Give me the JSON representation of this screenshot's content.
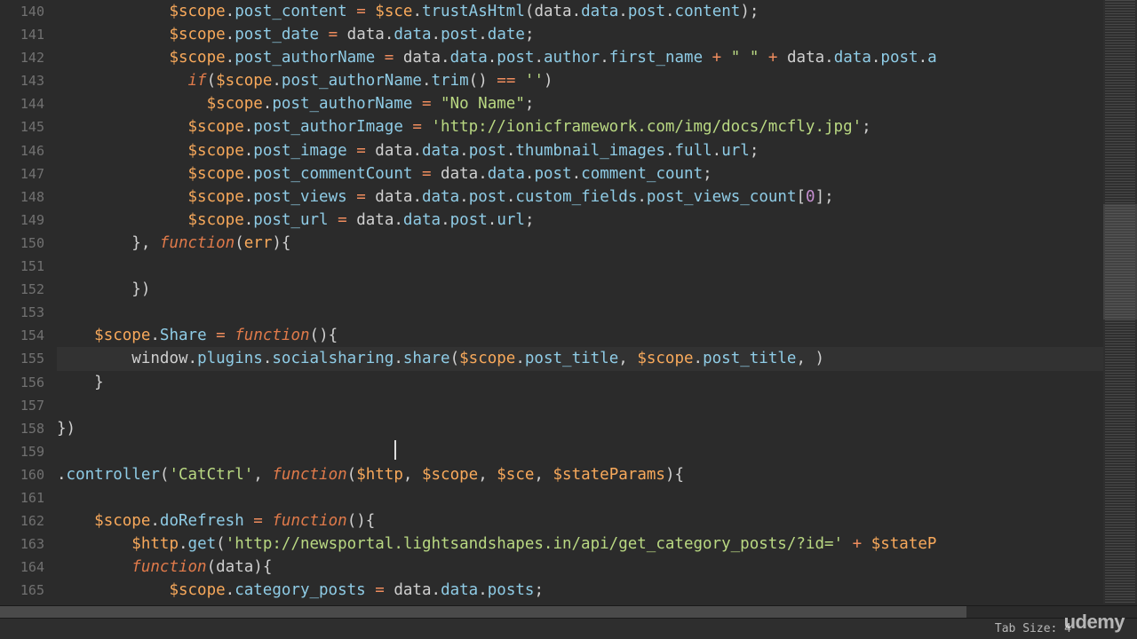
{
  "editor": {
    "first_line_number": 140,
    "active_line": 155,
    "cursor_after_line_index": 19,
    "tab_size_label": "Tab Size: 4"
  },
  "watermark": "udemy",
  "code_lines": [
    [
      [
        "            ",
        "s-punc"
      ],
      [
        "$scope",
        "s-var"
      ],
      [
        ".",
        "s-punc"
      ],
      [
        "post_content",
        "s-prop"
      ],
      [
        " ",
        "s-punc"
      ],
      [
        "=",
        "s-op"
      ],
      [
        " ",
        "s-punc"
      ],
      [
        "$sce",
        "s-var"
      ],
      [
        ".",
        "s-punc"
      ],
      [
        "trustAsHtml",
        "s-prop"
      ],
      [
        "(",
        "s-punc"
      ],
      [
        "data",
        "s-ident"
      ],
      [
        ".",
        "s-punc"
      ],
      [
        "data",
        "s-prop"
      ],
      [
        ".",
        "s-punc"
      ],
      [
        "post",
        "s-prop"
      ],
      [
        ".",
        "s-punc"
      ],
      [
        "content",
        "s-prop"
      ],
      [
        ");",
        "s-punc"
      ]
    ],
    [
      [
        "            ",
        "s-punc"
      ],
      [
        "$scope",
        "s-var"
      ],
      [
        ".",
        "s-punc"
      ],
      [
        "post_date",
        "s-prop"
      ],
      [
        " ",
        "s-punc"
      ],
      [
        "=",
        "s-op"
      ],
      [
        " ",
        "s-punc"
      ],
      [
        "data",
        "s-ident"
      ],
      [
        ".",
        "s-punc"
      ],
      [
        "data",
        "s-prop"
      ],
      [
        ".",
        "s-punc"
      ],
      [
        "post",
        "s-prop"
      ],
      [
        ".",
        "s-punc"
      ],
      [
        "date",
        "s-prop"
      ],
      [
        ";",
        "s-punc"
      ]
    ],
    [
      [
        "            ",
        "s-punc"
      ],
      [
        "$scope",
        "s-var"
      ],
      [
        ".",
        "s-punc"
      ],
      [
        "post_authorName",
        "s-prop"
      ],
      [
        " ",
        "s-punc"
      ],
      [
        "=",
        "s-op"
      ],
      [
        " ",
        "s-punc"
      ],
      [
        "data",
        "s-ident"
      ],
      [
        ".",
        "s-punc"
      ],
      [
        "data",
        "s-prop"
      ],
      [
        ".",
        "s-punc"
      ],
      [
        "post",
        "s-prop"
      ],
      [
        ".",
        "s-punc"
      ],
      [
        "author",
        "s-prop"
      ],
      [
        ".",
        "s-punc"
      ],
      [
        "first_name",
        "s-prop"
      ],
      [
        " ",
        "s-punc"
      ],
      [
        "+",
        "s-op"
      ],
      [
        " ",
        "s-punc"
      ],
      [
        "\" \"",
        "s-str"
      ],
      [
        " ",
        "s-punc"
      ],
      [
        "+",
        "s-op"
      ],
      [
        " ",
        "s-punc"
      ],
      [
        "data",
        "s-ident"
      ],
      [
        ".",
        "s-punc"
      ],
      [
        "data",
        "s-prop"
      ],
      [
        ".",
        "s-punc"
      ],
      [
        "post",
        "s-prop"
      ],
      [
        ".",
        "s-punc"
      ],
      [
        "a",
        "s-prop"
      ]
    ],
    [
      [
        "              ",
        "s-punc"
      ],
      [
        "if",
        "s-kw"
      ],
      [
        "(",
        "s-punc"
      ],
      [
        "$scope",
        "s-var"
      ],
      [
        ".",
        "s-punc"
      ],
      [
        "post_authorName",
        "s-prop"
      ],
      [
        ".",
        "s-punc"
      ],
      [
        "trim",
        "s-prop"
      ],
      [
        "()",
        " s-punc"
      ],
      [
        " ",
        "s-punc"
      ],
      [
        "==",
        "s-op"
      ],
      [
        " ",
        "s-punc"
      ],
      [
        "''",
        "s-str"
      ],
      [
        ")",
        "s-punc"
      ]
    ],
    [
      [
        "                ",
        "s-punc"
      ],
      [
        "$scope",
        "s-var"
      ],
      [
        ".",
        "s-punc"
      ],
      [
        "post_authorName",
        "s-prop"
      ],
      [
        " ",
        "s-punc"
      ],
      [
        "=",
        "s-op"
      ],
      [
        " ",
        "s-punc"
      ],
      [
        "\"No Name\"",
        "s-str"
      ],
      [
        ";",
        "s-punc"
      ]
    ],
    [
      [
        "              ",
        "s-punc"
      ],
      [
        "$scope",
        "s-var"
      ],
      [
        ".",
        "s-punc"
      ],
      [
        "post_authorImage",
        "s-prop"
      ],
      [
        " ",
        "s-punc"
      ],
      [
        "=",
        "s-op"
      ],
      [
        " ",
        "s-punc"
      ],
      [
        "'http://ionicframework.com/img/docs/mcfly.jpg'",
        "s-str"
      ],
      [
        ";",
        "s-punc"
      ]
    ],
    [
      [
        "              ",
        "s-punc"
      ],
      [
        "$scope",
        "s-var"
      ],
      [
        ".",
        "s-punc"
      ],
      [
        "post_image",
        "s-prop"
      ],
      [
        " ",
        "s-punc"
      ],
      [
        "=",
        "s-op"
      ],
      [
        " ",
        "s-punc"
      ],
      [
        "data",
        "s-ident"
      ],
      [
        ".",
        "s-punc"
      ],
      [
        "data",
        "s-prop"
      ],
      [
        ".",
        "s-punc"
      ],
      [
        "post",
        "s-prop"
      ],
      [
        ".",
        "s-punc"
      ],
      [
        "thumbnail_images",
        "s-prop"
      ],
      [
        ".",
        "s-punc"
      ],
      [
        "full",
        "s-prop"
      ],
      [
        ".",
        "s-punc"
      ],
      [
        "url",
        "s-prop"
      ],
      [
        ";",
        "s-punc"
      ]
    ],
    [
      [
        "              ",
        "s-punc"
      ],
      [
        "$scope",
        "s-var"
      ],
      [
        ".",
        "s-punc"
      ],
      [
        "post_commentCount",
        "s-prop"
      ],
      [
        " ",
        "s-punc"
      ],
      [
        "=",
        "s-op"
      ],
      [
        " ",
        "s-punc"
      ],
      [
        "data",
        "s-ident"
      ],
      [
        ".",
        "s-punc"
      ],
      [
        "data",
        "s-prop"
      ],
      [
        ".",
        "s-punc"
      ],
      [
        "post",
        "s-prop"
      ],
      [
        ".",
        "s-punc"
      ],
      [
        "comment_count",
        "s-prop"
      ],
      [
        ";",
        "s-punc"
      ]
    ],
    [
      [
        "              ",
        "s-punc"
      ],
      [
        "$scope",
        "s-var"
      ],
      [
        ".",
        "s-punc"
      ],
      [
        "post_views",
        "s-prop"
      ],
      [
        " ",
        "s-punc"
      ],
      [
        "=",
        "s-op"
      ],
      [
        " ",
        "s-punc"
      ],
      [
        "data",
        "s-ident"
      ],
      [
        ".",
        "s-punc"
      ],
      [
        "data",
        "s-prop"
      ],
      [
        ".",
        "s-punc"
      ],
      [
        "post",
        "s-prop"
      ],
      [
        ".",
        "s-punc"
      ],
      [
        "custom_fields",
        "s-prop"
      ],
      [
        ".",
        "s-punc"
      ],
      [
        "post_views_count",
        "s-prop"
      ],
      [
        "[",
        "s-punc"
      ],
      [
        "0",
        "s-num"
      ],
      [
        "];",
        "s-punc"
      ]
    ],
    [
      [
        "              ",
        "s-punc"
      ],
      [
        "$scope",
        "s-var"
      ],
      [
        ".",
        "s-punc"
      ],
      [
        "post_url",
        "s-prop"
      ],
      [
        " ",
        "s-punc"
      ],
      [
        "=",
        "s-op"
      ],
      [
        " ",
        "s-punc"
      ],
      [
        "data",
        "s-ident"
      ],
      [
        ".",
        "s-punc"
      ],
      [
        "data",
        "s-prop"
      ],
      [
        ".",
        "s-punc"
      ],
      [
        "post",
        "s-prop"
      ],
      [
        ".",
        "s-punc"
      ],
      [
        "url",
        "s-prop"
      ],
      [
        ";",
        "s-punc"
      ]
    ],
    [
      [
        "        }, ",
        "s-punc"
      ],
      [
        "function",
        "s-kw"
      ],
      [
        "(",
        "s-punc"
      ],
      [
        "err",
        "s-var"
      ],
      [
        "){",
        "s-punc"
      ]
    ],
    [
      [
        "",
        "s-punc"
      ]
    ],
    [
      [
        "        })",
        "s-punc"
      ]
    ],
    [
      [
        "",
        "s-punc"
      ]
    ],
    [
      [
        "    ",
        "s-punc"
      ],
      [
        "$scope",
        "s-var"
      ],
      [
        ".",
        "s-punc"
      ],
      [
        "Share",
        "s-prop"
      ],
      [
        " ",
        "s-punc"
      ],
      [
        "=",
        "s-op"
      ],
      [
        " ",
        "s-punc"
      ],
      [
        "function",
        "s-kw"
      ],
      [
        "(){",
        "s-punc"
      ]
    ],
    [
      [
        "        ",
        "s-punc"
      ],
      [
        "window",
        "s-ident"
      ],
      [
        ".",
        "s-punc"
      ],
      [
        "plugins",
        "s-prop"
      ],
      [
        ".",
        "s-punc"
      ],
      [
        "socialsharing",
        "s-prop"
      ],
      [
        ".",
        "s-punc"
      ],
      [
        "share",
        "s-prop"
      ],
      [
        "(",
        "s-punc"
      ],
      [
        "$scope",
        "s-var"
      ],
      [
        ".",
        "s-punc"
      ],
      [
        "post_title",
        "s-prop"
      ],
      [
        ", ",
        "s-punc"
      ],
      [
        "$scope",
        "s-var"
      ],
      [
        ".",
        "s-punc"
      ],
      [
        "post_title",
        "s-prop"
      ],
      [
        ", )",
        "s-punc"
      ]
    ],
    [
      [
        "    }",
        "s-punc"
      ]
    ],
    [
      [
        "",
        "s-punc"
      ]
    ],
    [
      [
        "})",
        "s-punc"
      ]
    ],
    [
      [
        "",
        "s-punc"
      ]
    ],
    [
      [
        ".",
        "s-punc"
      ],
      [
        "controller",
        "s-prop"
      ],
      [
        "(",
        "s-punc"
      ],
      [
        "'CatCtrl'",
        "s-str"
      ],
      [
        ", ",
        "s-punc"
      ],
      [
        "function",
        "s-kw"
      ],
      [
        "(",
        "s-punc"
      ],
      [
        "$http",
        "s-var"
      ],
      [
        ", ",
        "s-punc"
      ],
      [
        "$scope",
        "s-var"
      ],
      [
        ", ",
        "s-punc"
      ],
      [
        "$sce",
        "s-var"
      ],
      [
        ", ",
        "s-punc"
      ],
      [
        "$stateParams",
        "s-var"
      ],
      [
        "){",
        "s-punc"
      ]
    ],
    [
      [
        "",
        "s-punc"
      ]
    ],
    [
      [
        "    ",
        "s-punc"
      ],
      [
        "$scope",
        "s-var"
      ],
      [
        ".",
        "s-punc"
      ],
      [
        "doRefresh",
        "s-prop"
      ],
      [
        " ",
        "s-punc"
      ],
      [
        "=",
        "s-op"
      ],
      [
        " ",
        "s-punc"
      ],
      [
        "function",
        "s-kw"
      ],
      [
        "(){",
        "s-punc"
      ]
    ],
    [
      [
        "        ",
        "s-punc"
      ],
      [
        "$http",
        "s-var"
      ],
      [
        ".",
        "s-punc"
      ],
      [
        "get",
        "s-prop"
      ],
      [
        "(",
        "s-punc"
      ],
      [
        "'http://newsportal.lightsandshapes.in/api/get_category_posts/?id='",
        "s-str"
      ],
      [
        " ",
        "s-punc"
      ],
      [
        "+",
        "s-op"
      ],
      [
        " ",
        "s-punc"
      ],
      [
        "$stateP",
        "s-var"
      ]
    ],
    [
      [
        "        ",
        "s-punc"
      ],
      [
        "function",
        "s-kw"
      ],
      [
        "(",
        "s-punc"
      ],
      [
        "data",
        "s-ident"
      ],
      [
        "){",
        "s-punc"
      ]
    ],
    [
      [
        "            ",
        "s-punc"
      ],
      [
        "$scope",
        "s-var"
      ],
      [
        ".",
        "s-punc"
      ],
      [
        "category_posts",
        "s-prop"
      ],
      [
        " ",
        "s-punc"
      ],
      [
        "=",
        "s-op"
      ],
      [
        " ",
        "s-punc"
      ],
      [
        "data",
        "s-ident"
      ],
      [
        ".",
        "s-punc"
      ],
      [
        "data",
        "s-prop"
      ],
      [
        ".",
        "s-punc"
      ],
      [
        "posts",
        "s-prop"
      ],
      [
        ";",
        "s-punc"
      ]
    ]
  ]
}
